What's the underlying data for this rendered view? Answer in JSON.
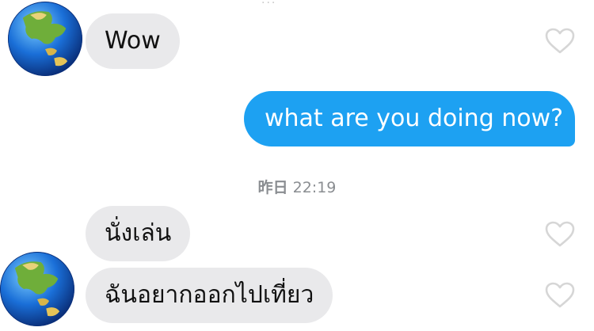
{
  "top_fragment": "...",
  "messages": [
    {
      "direction": "in",
      "text": "Wow"
    },
    {
      "direction": "out",
      "text": "what are you doing now?"
    },
    {
      "direction": "in",
      "text": "นั่งเล่น"
    },
    {
      "direction": "in",
      "text": "ฉันอยากออกไปเที่ยว"
    }
  ],
  "timestamp": {
    "day": "昨日",
    "time": "22:19"
  },
  "icons": {
    "avatar": "earth-globe-asia-icon",
    "like": "heart-outline-icon"
  },
  "colors": {
    "incoming_bubble": "#e9e9eb",
    "outgoing_bubble": "#1da1f2",
    "heart": "#d6d6d6"
  }
}
